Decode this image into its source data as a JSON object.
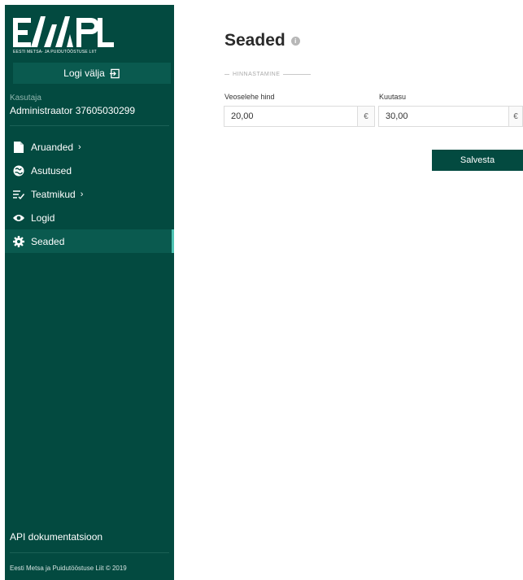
{
  "sidebar": {
    "logo_sub": "EESTI METSA- JA PUIDUTÖÖSTUSE LIIT",
    "logout_label": "Logi välja",
    "user_label": "Kasutaja",
    "user_name": "Administraator 37605030299",
    "nav": [
      {
        "label": "Aruanded",
        "icon": "document-icon",
        "has_submenu": true
      },
      {
        "label": "Asutused",
        "icon": "globe-icon",
        "has_submenu": false
      },
      {
        "label": "Teatmikud",
        "icon": "list-check-icon",
        "has_submenu": true
      },
      {
        "label": "Logid",
        "icon": "eye-icon",
        "has_submenu": false
      },
      {
        "label": "Seaded",
        "icon": "gear-icon",
        "has_submenu": false,
        "active": true
      }
    ],
    "api_link": "API dokumentatsioon",
    "footer": "Eesti Metsa ja Puidutööstuse Liit © 2019"
  },
  "main": {
    "title": "Seaded",
    "section": "HINNASTAMINE",
    "fields": [
      {
        "label": "Veoselehe hind",
        "value": "20,00",
        "unit": "€"
      },
      {
        "label": "Kuutasu",
        "value": "30,00",
        "unit": "€"
      }
    ],
    "save_label": "Salvesta"
  },
  "colors": {
    "sidebar_bg": "#034a40",
    "accent": "#4fc3b3"
  }
}
